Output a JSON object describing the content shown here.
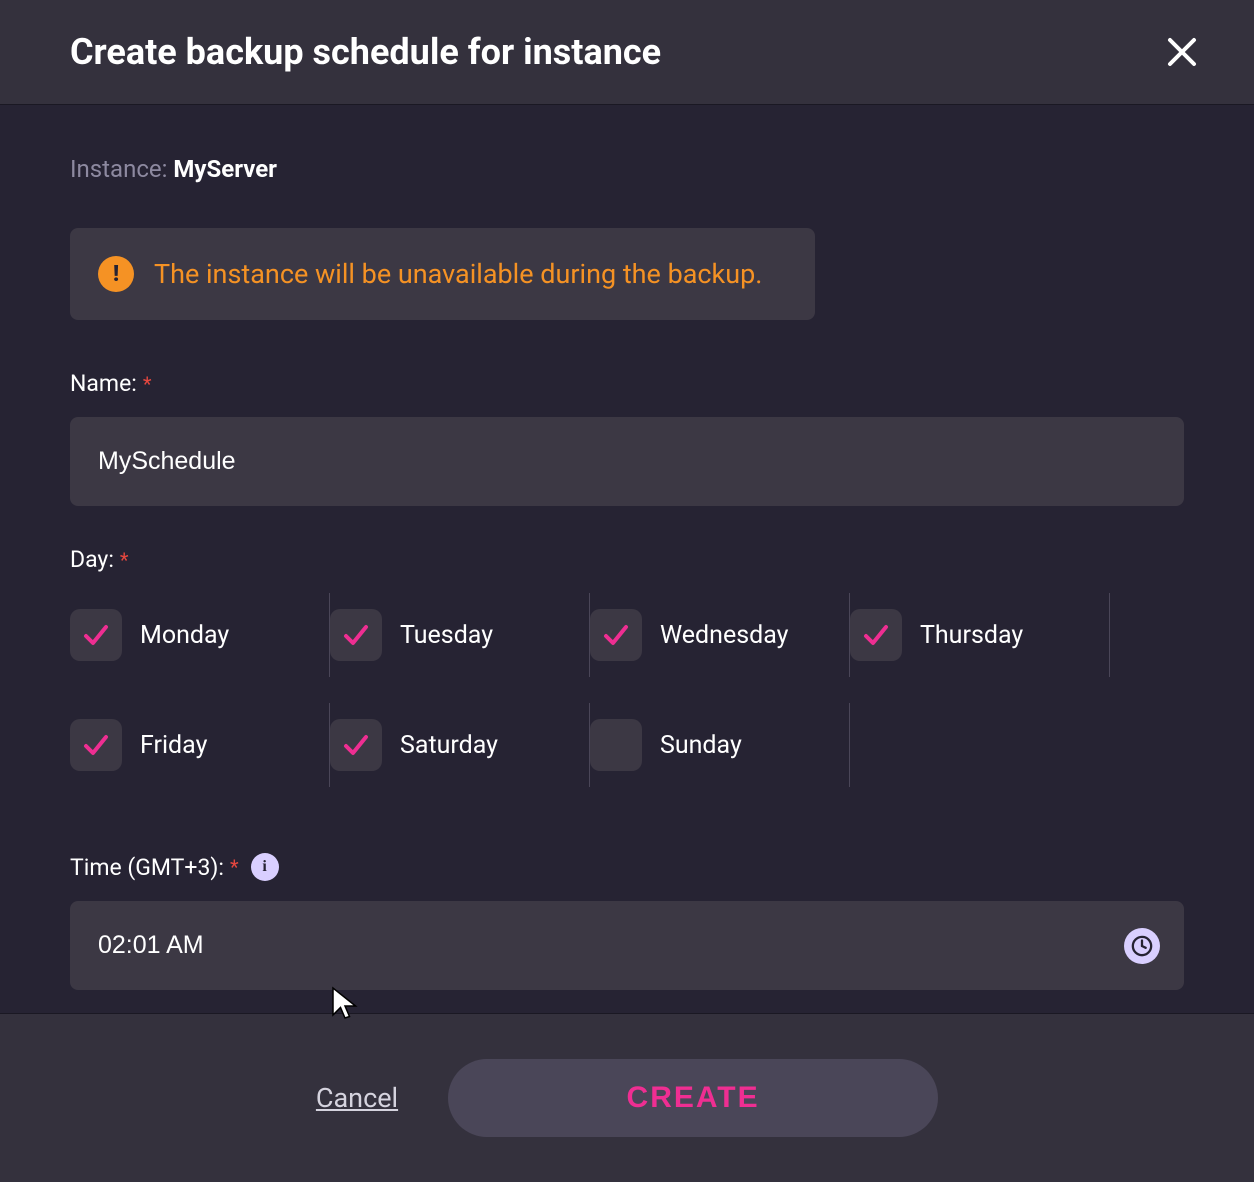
{
  "header": {
    "title": "Create backup schedule for instance"
  },
  "instance": {
    "label": "Instance: ",
    "name": "MyServer"
  },
  "warning": {
    "text": "The instance will be unavailable during the backup."
  },
  "nameField": {
    "label": "Name:",
    "value": "MySchedule"
  },
  "dayField": {
    "label": "Day:",
    "days": [
      {
        "label": "Monday",
        "checked": true
      },
      {
        "label": "Tuesday",
        "checked": true
      },
      {
        "label": "Wednesday",
        "checked": true
      },
      {
        "label": "Thursday",
        "checked": true
      },
      {
        "label": "Friday",
        "checked": true
      },
      {
        "label": "Saturday",
        "checked": true
      },
      {
        "label": "Sunday",
        "checked": false
      }
    ]
  },
  "timeField": {
    "label": "Time (GMT+3):",
    "value": "02:01 AM"
  },
  "footer": {
    "cancel": "Cancel",
    "create": "CREATE"
  }
}
